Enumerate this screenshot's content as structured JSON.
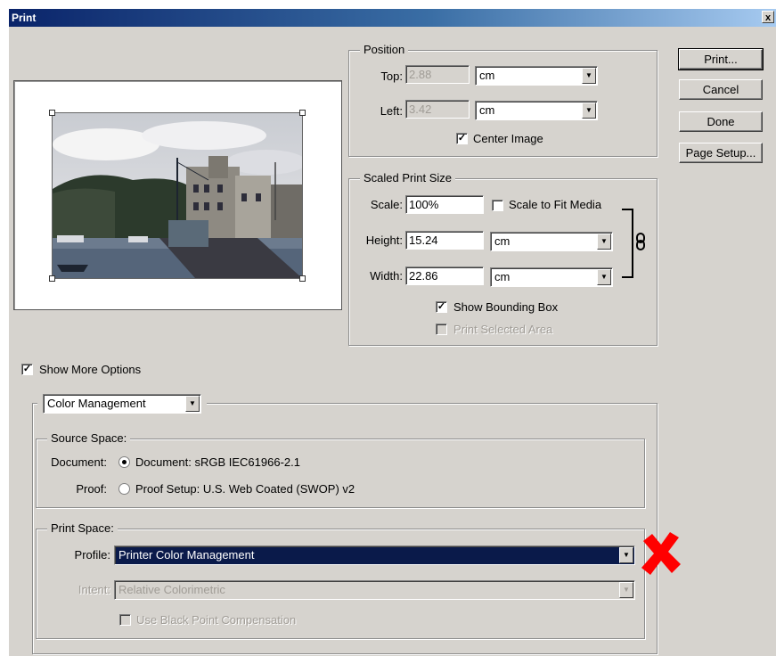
{
  "window": {
    "title": "Print",
    "close_glyph": "x"
  },
  "buttons": {
    "print": "Print...",
    "cancel": "Cancel",
    "done": "Done",
    "page_setup": "Page Setup..."
  },
  "position": {
    "legend": "Position",
    "top_label": "Top:",
    "top_value": "2.88",
    "top_unit": "cm",
    "left_label": "Left:",
    "left_value": "3.42",
    "left_unit": "cm",
    "center_image_label": "Center Image",
    "center_image_checked": true
  },
  "scaled": {
    "legend": "Scaled Print Size",
    "scale_label": "Scale:",
    "scale_value": "100%",
    "fit_label": "Scale to Fit Media",
    "fit_checked": false,
    "height_label": "Height:",
    "height_value": "15.24",
    "height_unit": "cm",
    "width_label": "Width:",
    "width_value": "22.86",
    "width_unit": "cm",
    "bounding_label": "Show Bounding Box",
    "bounding_checked": true,
    "selected_area_label": "Print Selected Area",
    "selected_area_checked": false
  },
  "more_options": {
    "label": "Show More Options",
    "checked": true
  },
  "options": {
    "dropdown": "Color Management",
    "source": {
      "legend": "Source Space:",
      "document_label": "Document:",
      "document_option": "Document:  sRGB IEC61966-2.1",
      "document_selected": true,
      "proof_label": "Proof:",
      "proof_option": "Proof Setup:  U.S. Web Coated (SWOP) v2",
      "proof_selected": false
    },
    "print_space": {
      "legend": "Print Space:",
      "profile_label": "Profile:",
      "profile_value": "Printer Color Management",
      "intent_label": "Intent:",
      "intent_value": "Relative Colorimetric",
      "bpc_label": "Use Black Point Compensation",
      "bpc_checked": false
    }
  },
  "icons": {
    "link": "chain-link-icon",
    "annotation": "red-x-mark-icon",
    "dropdown": "chevron-down-icon"
  },
  "colors": {
    "title_start": "#0a246a",
    "title_end": "#a6caf0",
    "dialog_bg": "#d6d3ce",
    "highlight": "#0a1a4a",
    "annotation": "#ff0000"
  }
}
